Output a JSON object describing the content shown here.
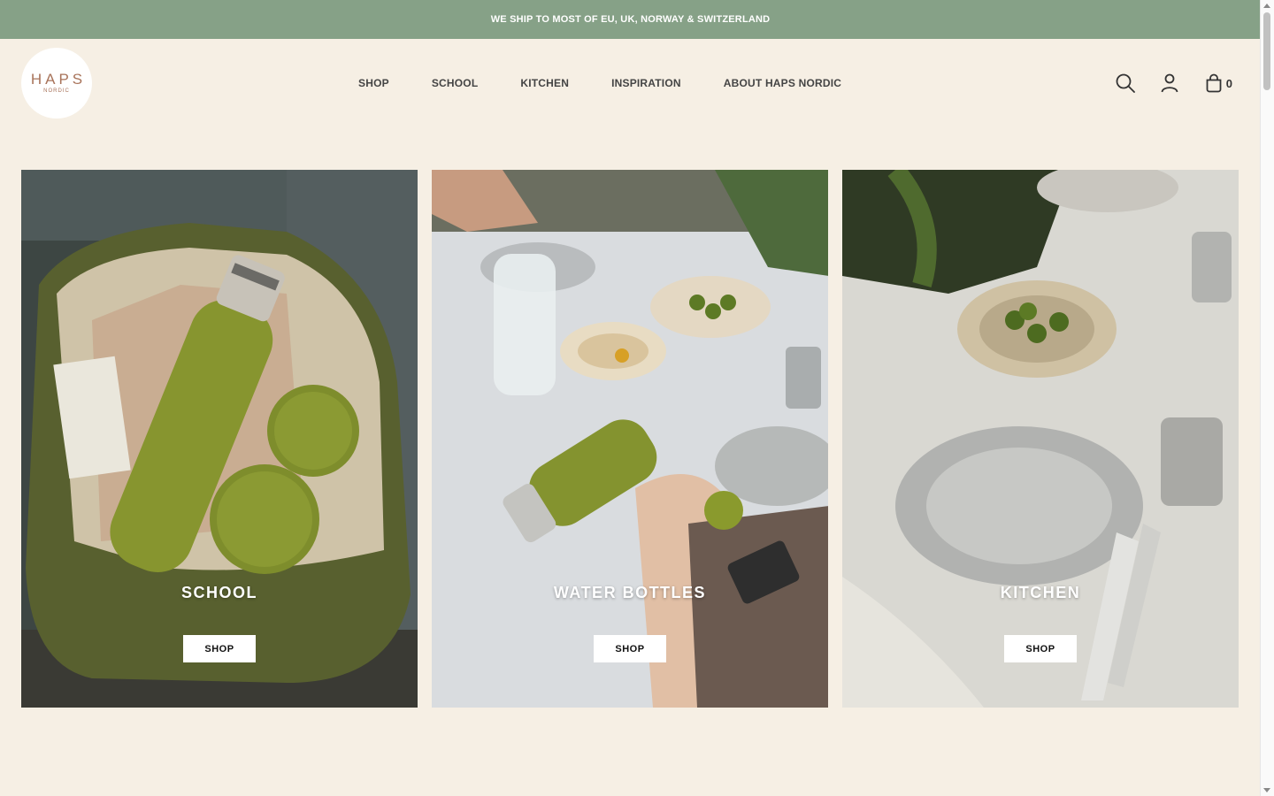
{
  "announcement": "WE SHIP TO MOST OF EU, UK, NORWAY & SWITZERLAND",
  "logo": {
    "main": "HAPS",
    "sub": "NORDIC"
  },
  "nav": [
    "SHOP",
    "SCHOOL",
    "KITCHEN",
    "INSPIRATION",
    "ABOUT HAPS NORDIC"
  ],
  "icons": [
    "search-icon",
    "account-icon",
    "cart-icon"
  ],
  "cart_count": "0",
  "tiles": [
    {
      "title": "SCHOOL",
      "button": "SHOP"
    },
    {
      "title": "WATER BOTTLES",
      "button": "SHOP"
    },
    {
      "title": "KITCHEN",
      "button": "SHOP"
    }
  ],
  "colors": {
    "announce_bg": "#86a187",
    "page_bg": "#f6efe4",
    "accent": "#a8735a",
    "olive": "#7d8a2e"
  }
}
